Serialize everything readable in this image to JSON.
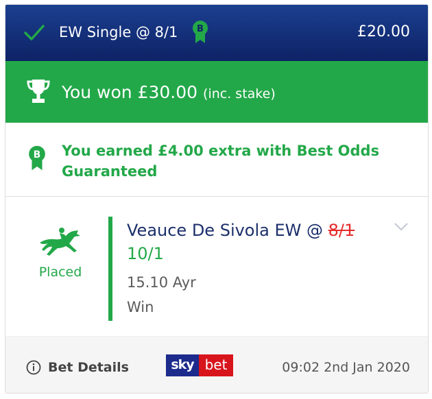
{
  "header": {
    "check_icon": "check-icon",
    "bet_type": "EW Single @ 8/1",
    "bog_icon": "best-odds-guaranteed-icon",
    "stake": "£20.00",
    "colors": {
      "background": "#0e2266",
      "check": "#23a849"
    }
  },
  "won": {
    "trophy_icon": "trophy-icon",
    "text": "You won £30.00",
    "subtext": "(inc. stake)",
    "color": "#23a849"
  },
  "bog": {
    "icon": "best-odds-guaranteed-icon",
    "text": "You earned £4.00 extra with Best Odds Guaranteed"
  },
  "selection": {
    "horse_icon": "horse-racing-icon",
    "status": "Placed",
    "name": "Veauce De Sivola EW @ ",
    "old_odds": "8/1",
    "new_odds": "10/1",
    "race": "15.10 Ayr",
    "market": "Win",
    "expand_icon": "chevron-down-icon"
  },
  "footer": {
    "info_icon": "info-icon",
    "details_label": "Bet Details",
    "logo": {
      "sky": "sky",
      "bet": "bet"
    },
    "timestamp": "09:02 2nd Jan 2020"
  }
}
